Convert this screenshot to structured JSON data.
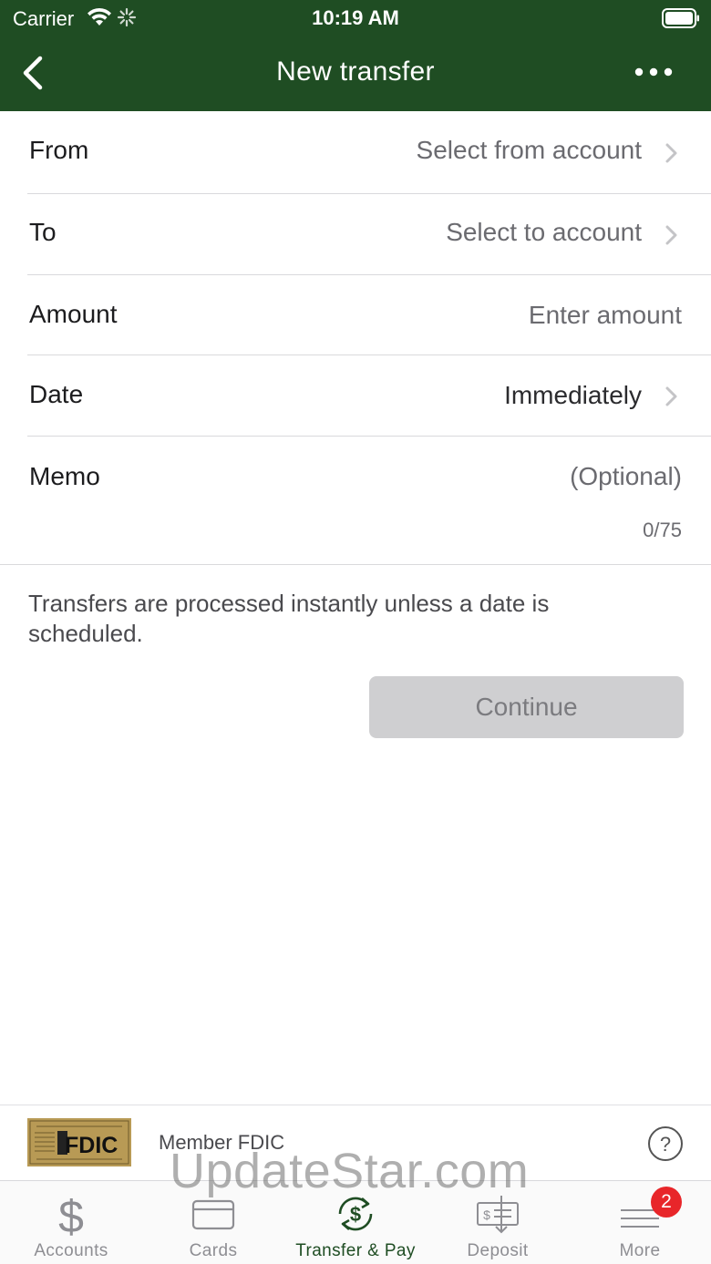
{
  "status_bar": {
    "carrier": "Carrier",
    "time": "10:19 AM"
  },
  "nav": {
    "title": "New transfer",
    "back_icon": "chevron-left-icon",
    "more_icon": "ellipsis-icon"
  },
  "form": {
    "from": {
      "label": "From",
      "value": "Select from account"
    },
    "to": {
      "label": "To",
      "value": "Select to account"
    },
    "amount": {
      "label": "Amount",
      "placeholder": "Enter amount"
    },
    "date": {
      "label": "Date",
      "value": "Immediately"
    },
    "memo": {
      "label": "Memo",
      "placeholder": "(Optional)",
      "counter": "0/75"
    }
  },
  "info": "Transfers are processed instantly unless a date is scheduled.",
  "continue_label": "Continue",
  "fdic": {
    "logo_text": "FDIC",
    "member_text": "Member FDIC"
  },
  "tabs": [
    {
      "label": "Accounts",
      "icon": "dollar-icon",
      "active": false
    },
    {
      "label": "Cards",
      "icon": "card-icon",
      "active": false
    },
    {
      "label": "Transfer & Pay",
      "icon": "transfer-icon",
      "active": true
    },
    {
      "label": "Deposit",
      "icon": "check-deposit-icon",
      "active": false
    },
    {
      "label": "More",
      "icon": "menu-icon",
      "active": false,
      "badge": "2"
    }
  ],
  "watermark": "UpdateStar.com",
  "colors": {
    "header_bg": "#1f4d23",
    "accent": "#1f4d23",
    "badge": "#e8262a",
    "button_disabled": "#cfcfd1"
  }
}
